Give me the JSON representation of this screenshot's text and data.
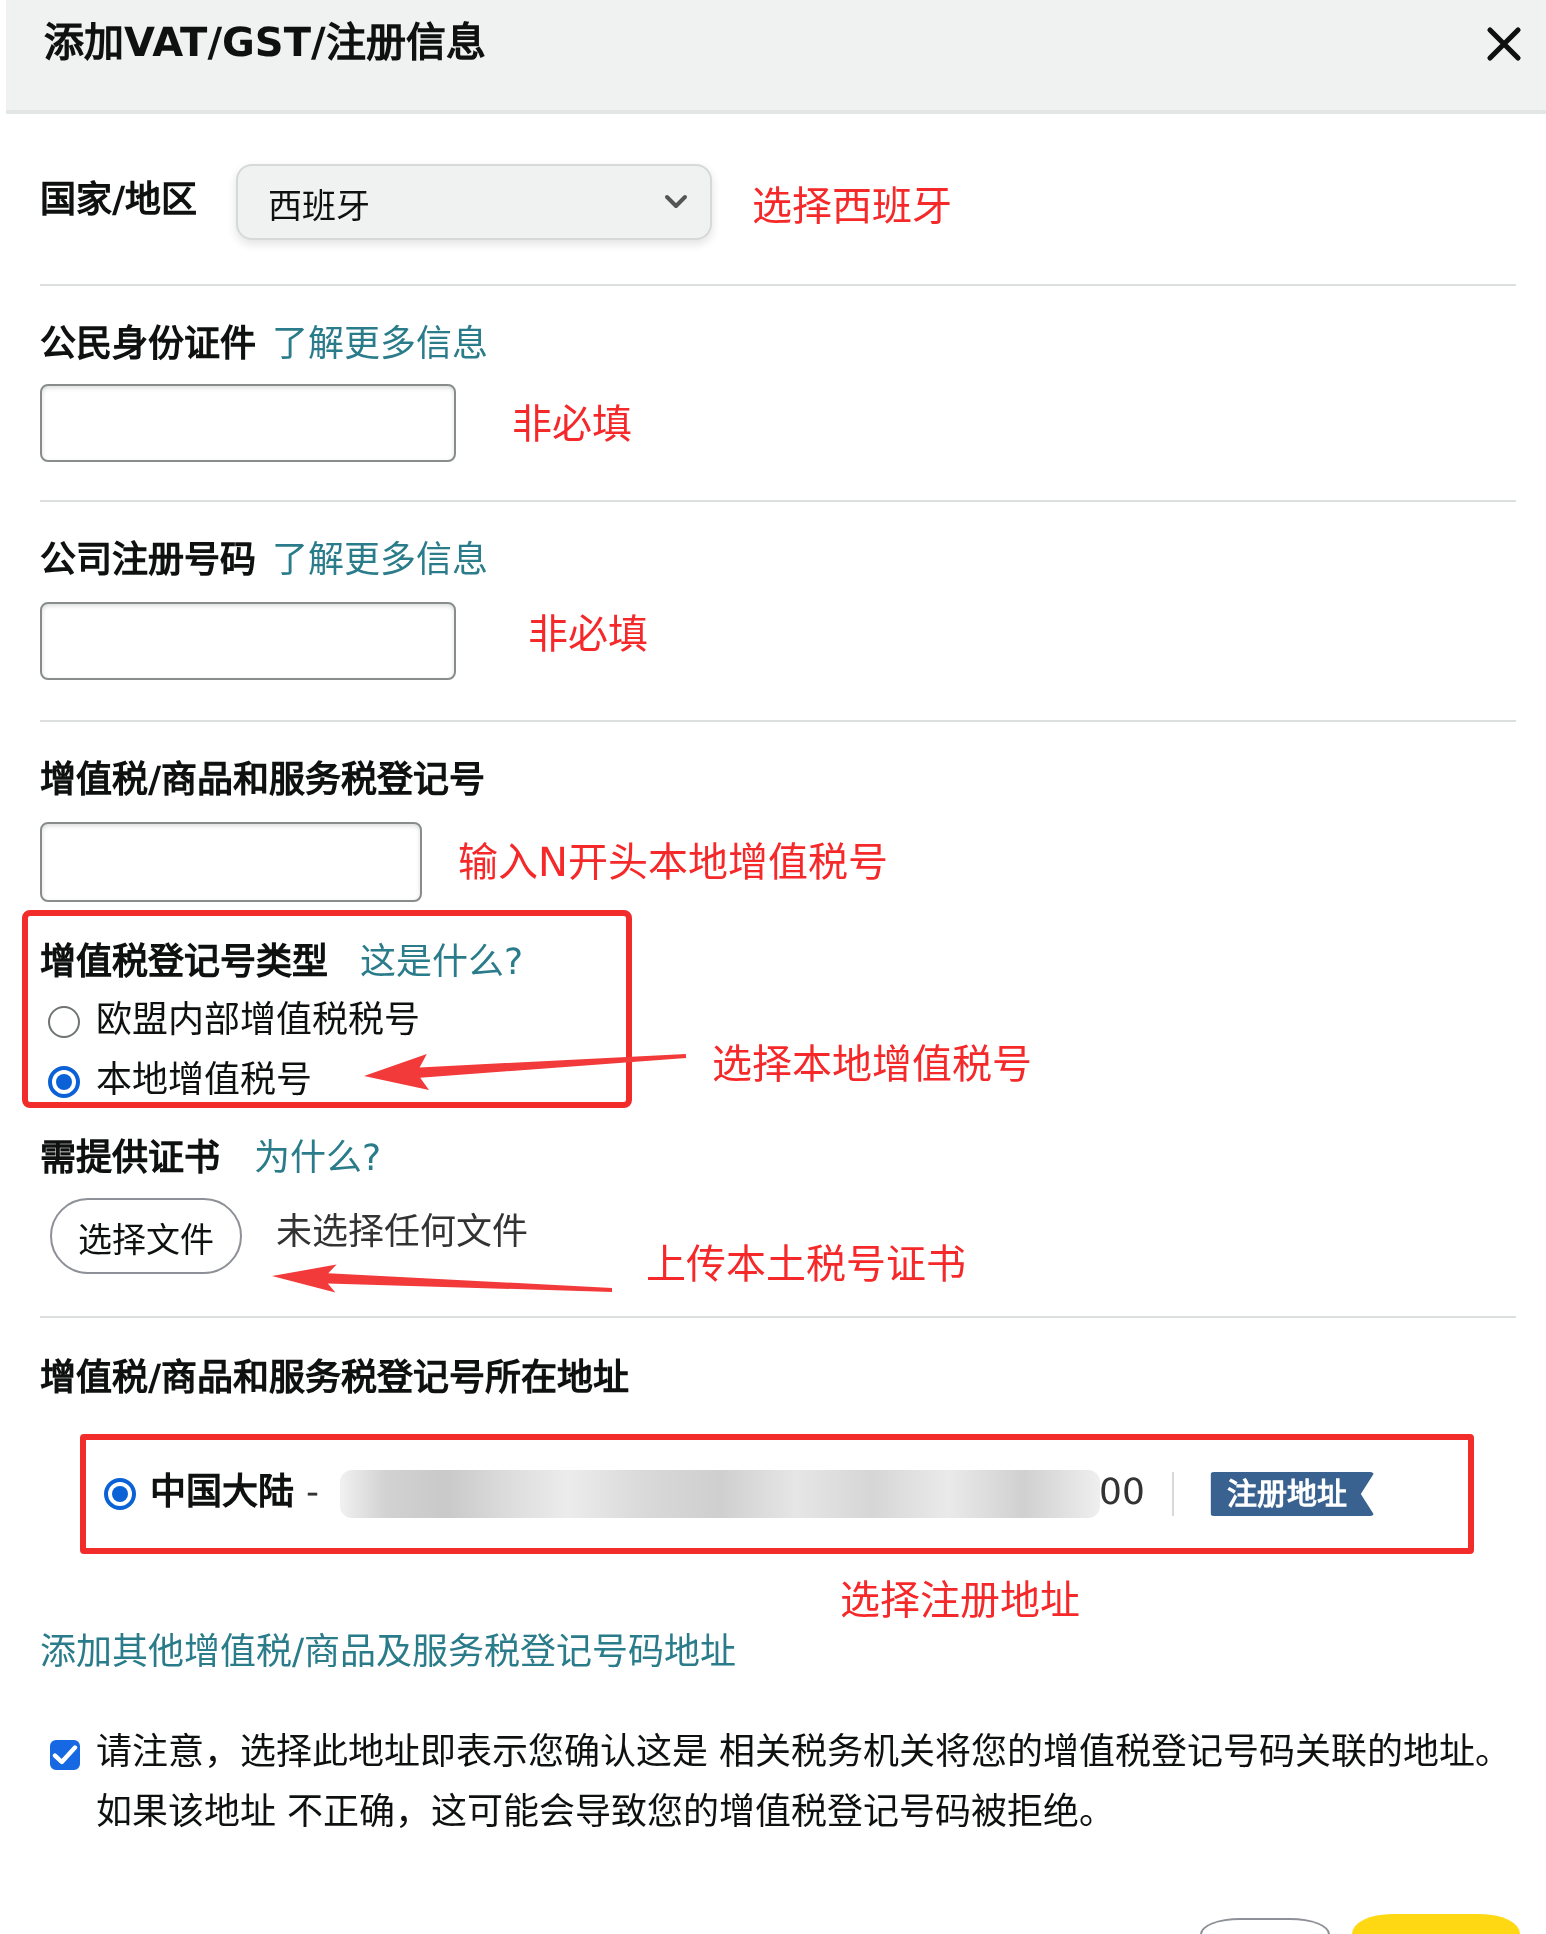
{
  "dialog": {
    "title": "添加VAT/GST/注册信息"
  },
  "country": {
    "label": "国家/地区",
    "value": "西班牙",
    "annotation": "选择西班牙"
  },
  "citizen_id": {
    "label": "公民身份证件",
    "link": "了解更多信息",
    "annotation": "非必填"
  },
  "company_number": {
    "label": "公司注册号码",
    "link": "了解更多信息",
    "annotation": "非必填"
  },
  "vat_number": {
    "label": "增值税/商品和服务税登记号",
    "annotation": "输入N开头本地增值税号"
  },
  "vat_type": {
    "label": "增值税登记号类型",
    "link": "这是什么?",
    "options": [
      {
        "label": "欧盟内部增值税税号",
        "selected": false
      },
      {
        "label": "本地增值税号",
        "selected": true
      }
    ],
    "annotation": "选择本地增值税号"
  },
  "certificate": {
    "label": "需提供证书",
    "link": "为什么?",
    "button": "选择文件",
    "file_status": "未选择任何文件",
    "annotation": "上传本土税号证书"
  },
  "address": {
    "label": "增值税/商品和服务税登记号所在地址",
    "options": [
      {
        "selected": true,
        "region": "中国大陆",
        "text_start": "-",
        "text_end": "00",
        "badge": "注册地址"
      }
    ],
    "annotation": "选择注册地址",
    "add_link": "添加其他增值税/商品及服务税登记号码地址"
  },
  "notice": {
    "checked": true,
    "text": "请注意，选择此地址即表示您确认这是 相关税务机关将您的增值税登记号码关联的地址。如果该地址 不正确，这可能会导致您的增值税登记号码被拒绝。"
  },
  "footer": {
    "buttons": [
      {
        "kind": "secondary"
      },
      {
        "kind": "primary"
      }
    ]
  }
}
